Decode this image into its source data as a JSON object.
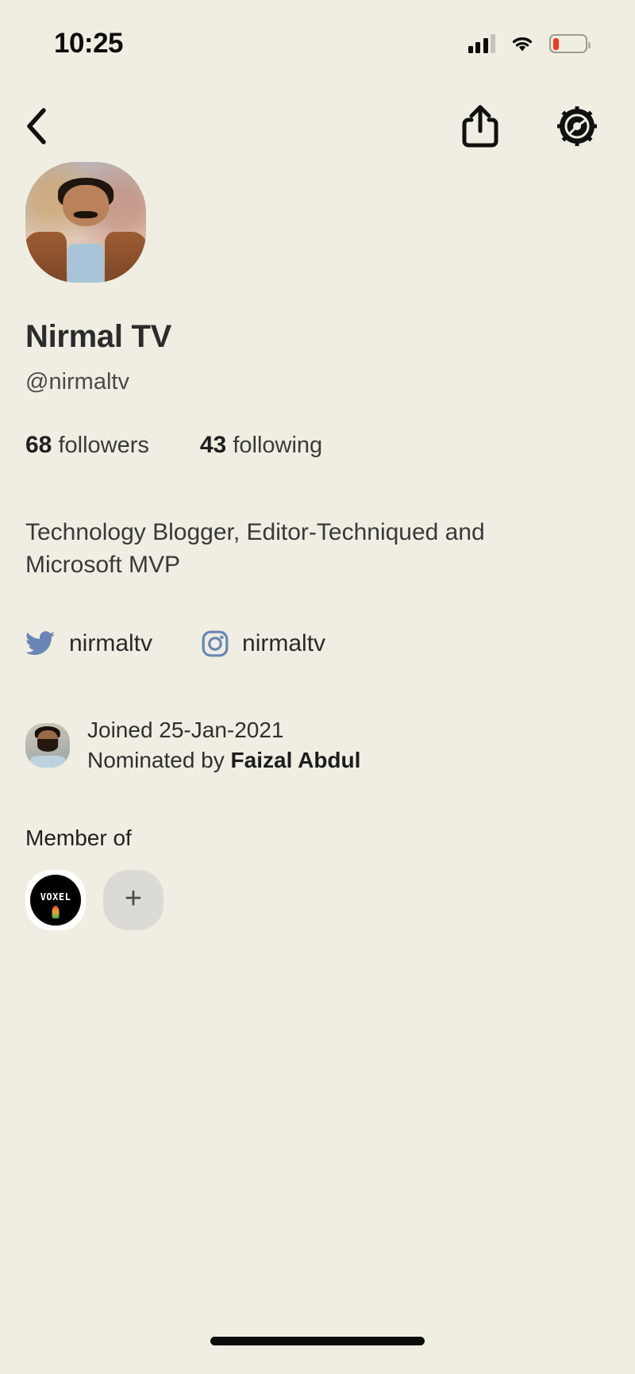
{
  "status_bar": {
    "time": "10:25",
    "signal_icon": "cellular-signal-icon",
    "wifi_icon": "wifi-icon",
    "battery_icon": "battery-low-icon",
    "battery_level_percent": 20,
    "battery_color": "#f03c22"
  },
  "nav": {
    "back_icon": "back-chevron-icon",
    "share_icon": "share-icon",
    "settings_icon": "gear-icon"
  },
  "profile": {
    "avatar_icon": "profile-avatar",
    "name": "Nirmal TV",
    "handle": "@nirmaltv",
    "followers_count": "68",
    "followers_label": "followers",
    "following_count": "43",
    "following_label": "following",
    "bio": "Technology Blogger, Editor-Techniqued and Microsoft MVP"
  },
  "socials": [
    {
      "icon": "twitter-icon",
      "handle": "nirmaltv",
      "color": "#6a85b6"
    },
    {
      "icon": "instagram-icon",
      "handle": "nirmaltv",
      "color": "#6a85b6"
    }
  ],
  "meta": {
    "nominator_avatar_icon": "nominator-avatar",
    "joined_text": "Joined 25-Jan-2021",
    "nominated_prefix": "Nominated by ",
    "nominated_by": "Faizal Abdul"
  },
  "member_of": {
    "title": "Member of",
    "clubs": [
      {
        "name": "VOXEL",
        "logo_text": "VOXEL",
        "icon": "club-voxel-logo"
      }
    ],
    "add_label": "+",
    "add_icon": "add-club-icon"
  },
  "home_indicator": "home-indicator",
  "theme": {
    "background": "#f0eee2",
    "text": "#2c2c2c",
    "accent": "#6a85b6"
  }
}
